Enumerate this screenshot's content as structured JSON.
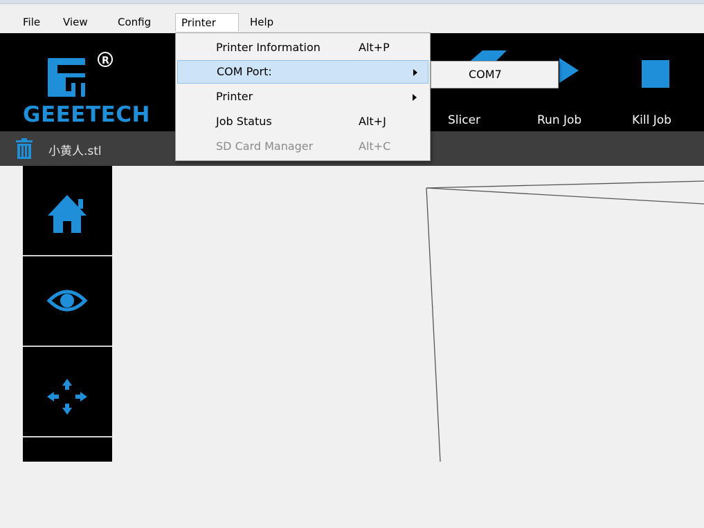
{
  "menubar": {
    "items": [
      "File",
      "View",
      "Config",
      "Printer",
      "Help"
    ],
    "open_index": 3
  },
  "logo": {
    "text": "GEEETECH",
    "registered": "®"
  },
  "toolbar": {
    "tools": [
      {
        "label": "Slicer",
        "icon": "slicer-icon"
      },
      {
        "label": "Run Job",
        "icon": "play-icon"
      },
      {
        "label": "Kill Job",
        "icon": "stop-icon"
      }
    ],
    "accent_color": "#1e8fd8"
  },
  "filebar": {
    "file_name": "小黄人.stl",
    "icon": "trash-icon"
  },
  "sidebar": {
    "buttons": [
      {
        "icon": "home-icon"
      },
      {
        "icon": "eye-icon"
      },
      {
        "icon": "move-arrows-icon"
      }
    ]
  },
  "printer_menu": {
    "items": [
      {
        "label": "Printer Information",
        "shortcut": "Alt+P",
        "submenu": false,
        "highlighted": false,
        "disabled": false
      },
      {
        "label": "COM Port:",
        "shortcut": "",
        "submenu": true,
        "highlighted": true,
        "disabled": false
      },
      {
        "label": "Printer",
        "shortcut": "",
        "submenu": true,
        "highlighted": false,
        "disabled": false
      },
      {
        "label": "Job Status",
        "shortcut": "Alt+J",
        "submenu": false,
        "highlighted": false,
        "disabled": false
      },
      {
        "label": "SD Card Manager",
        "shortcut": "Alt+C",
        "submenu": false,
        "highlighted": false,
        "disabled": true
      }
    ]
  },
  "com_submenu": {
    "items": [
      "COM7"
    ]
  }
}
